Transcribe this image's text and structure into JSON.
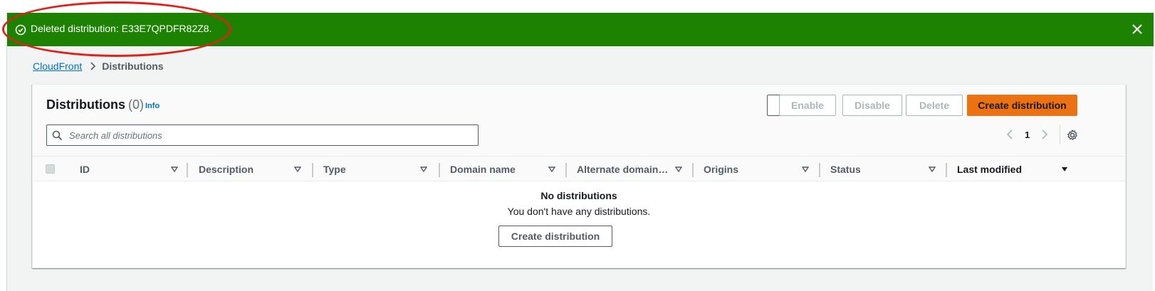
{
  "flash": {
    "message": "Deleted distribution: E33E7QPDFR82Z8.",
    "icon": "check-circle-icon",
    "close_icon": "close-icon",
    "color": "#1d8102"
  },
  "breadcrumb": {
    "root": "CloudFront",
    "current": "Distributions"
  },
  "panel": {
    "title": "Distributions",
    "count": "(0)",
    "info": "Info",
    "buttons": {
      "enable": "Enable",
      "disable": "Disable",
      "delete": "Delete",
      "create": "Create distribution"
    },
    "search_placeholder": "Search all distributions",
    "page": "1"
  },
  "table": {
    "columns": [
      {
        "label": "ID",
        "sort": "unsorted"
      },
      {
        "label": "Description",
        "sort": "unsorted"
      },
      {
        "label": "Type",
        "sort": "unsorted"
      },
      {
        "label": "Domain name",
        "sort": "unsorted"
      },
      {
        "label": "Alternate domain n...",
        "sort": "unsorted"
      },
      {
        "label": "Origins",
        "sort": "unsorted"
      },
      {
        "label": "Status",
        "sort": "unsorted"
      },
      {
        "label": "Last modified",
        "sort": "descending"
      }
    ],
    "empty_title": "No distributions",
    "empty_message": "You don't have any distributions.",
    "empty_button": "Create distribution"
  },
  "colors": {
    "primary": "#ec7211",
    "link": "#0073bb",
    "annotation": "#e0201b"
  }
}
